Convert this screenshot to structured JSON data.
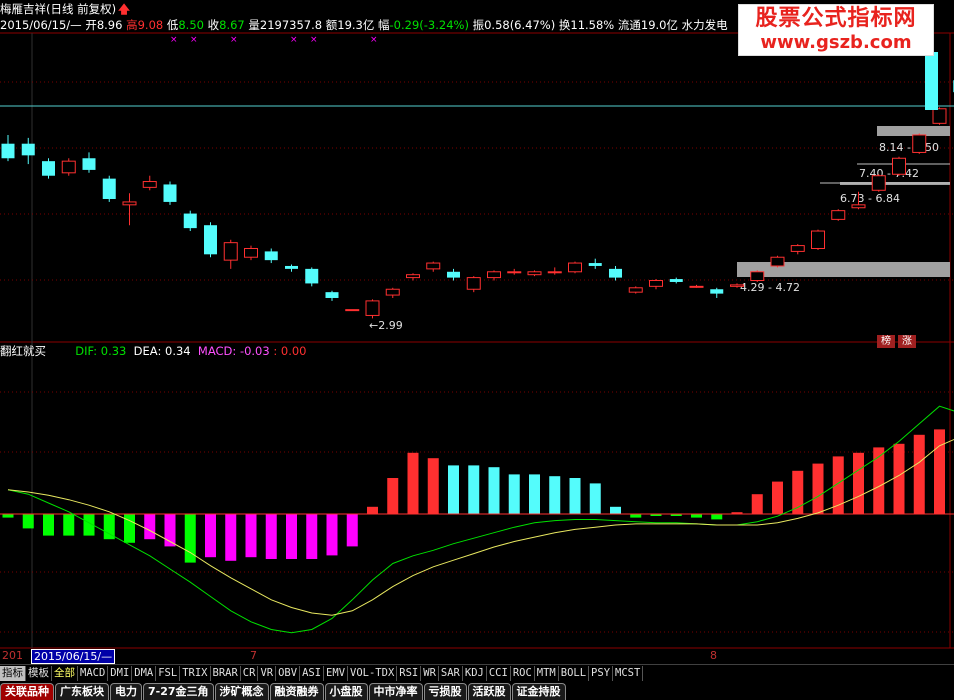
{
  "header": {
    "name": "梅雁吉祥",
    "period": "(日线 前复权)",
    "date": "2015/06/15/—",
    "open_label": "开",
    "open": "8.96",
    "high_label": "高",
    "high": "9.08",
    "low_label": "低",
    "low": "8.50",
    "close_label": "收",
    "close": "8.67",
    "volume_label": "量",
    "volume": "2197357.8",
    "amount_label": "额",
    "amount": "19.3亿",
    "change_label": "幅",
    "change": "-0.29(-3.24%)",
    "amplitude_label": "振",
    "amplitude": "0.58(6.47%)",
    "turnover_label": "换",
    "turnover": "11.58%",
    "float_label": "流通",
    "float": "19.0亿",
    "sector": "水力发电"
  },
  "watermark": {
    "line1": "股票公式指标网",
    "line2": "www.gszb.com"
  },
  "price_labels": [
    "8.14 - 8.50",
    "7.40 - 7.42",
    "6.73 - 6.84",
    "4.29 - 4.72"
  ],
  "low_marker": "2.99",
  "badges": [
    "榜",
    "涨"
  ],
  "indicator": {
    "name": "翻红就买",
    "dif_label": "DIF:",
    "dif": "0.33",
    "dea_label": "DEA:",
    "dea": "0.34",
    "macd_label": "MACD:",
    "macd": "-0.03",
    "extra": ": 0.00"
  },
  "axis": {
    "date_box": "2015/06/15/—",
    "left_cut": "201",
    "label_7": "7",
    "label_8": "8"
  },
  "tabs_row1": [
    "指标",
    "模板",
    "全部",
    "MACD",
    "DMI",
    "DMA",
    "FSL",
    "TRIX",
    "BRAR",
    "CR",
    "VR",
    "OBV",
    "ASI",
    "EMV",
    "VOL-TDX",
    "RSI",
    "WR",
    "SAR",
    "KDJ",
    "CCI",
    "ROC",
    "MTM",
    "BOLL",
    "PSY",
    "MCST"
  ],
  "tabs_row2": [
    "关联品种",
    "广东板块",
    "电力",
    "7-27金三角",
    "涉矿概念",
    "融资融券",
    "小盘股",
    "中市净率",
    "亏损股",
    "活跃股",
    "证金持股"
  ],
  "colors": {
    "up": "#ff3030",
    "down": "#54fcfc",
    "magenta": "#ff00ff",
    "green": "#00ff00",
    "dif": "#00e000",
    "dea": "#e8e860"
  },
  "chart_data": {
    "type": "candlestick",
    "candles": [
      {
        "o": 6.9,
        "c": 6.4,
        "h": 7.2,
        "l": 6.3
      },
      {
        "o": 6.9,
        "c": 6.5,
        "h": 7.1,
        "l": 6.2
      },
      {
        "o": 6.3,
        "c": 5.8,
        "h": 6.4,
        "l": 5.7
      },
      {
        "o": 5.9,
        "c": 6.3,
        "h": 6.4,
        "l": 5.8
      },
      {
        "o": 6.4,
        "c": 6.0,
        "h": 6.6,
        "l": 5.9
      },
      {
        "o": 5.7,
        "c": 5.0,
        "h": 5.8,
        "l": 4.9
      },
      {
        "o": 4.8,
        "c": 4.9,
        "h": 5.2,
        "l": 4.1
      },
      {
        "o": 5.4,
        "c": 5.6,
        "h": 5.8,
        "l": 5.3
      },
      {
        "o": 5.5,
        "c": 4.9,
        "h": 5.6,
        "l": 4.8
      },
      {
        "o": 4.5,
        "c": 4.0,
        "h": 4.6,
        "l": 3.9
      },
      {
        "o": 4.1,
        "c": 3.1,
        "h": 4.2,
        "l": 3.0
      },
      {
        "o": 2.9,
        "c": 3.5,
        "h": 3.6,
        "l": 2.6
      },
      {
        "o": 3.0,
        "c": 3.3,
        "h": 3.4,
        "l": 2.9
      },
      {
        "o": 3.2,
        "c": 2.9,
        "h": 3.3,
        "l": 2.8
      },
      {
        "o": 2.7,
        "c": 2.6,
        "h": 2.75,
        "l": 2.5
      },
      {
        "o": 2.6,
        "c": 2.1,
        "h": 2.65,
        "l": 2.0
      },
      {
        "o": 1.8,
        "c": 1.6,
        "h": 1.85,
        "l": 1.5
      },
      {
        "o": 1.2,
        "c": 1.2,
        "h": 1.2,
        "l": 1.2
      },
      {
        "o": 1.0,
        "c": 1.5,
        "h": 1.55,
        "l": 0.9
      },
      {
        "o": 1.7,
        "c": 1.9,
        "h": 1.95,
        "l": 1.6
      },
      {
        "o": 2.3,
        "c": 2.4,
        "h": 2.45,
        "l": 2.2
      },
      {
        "o": 2.6,
        "c": 2.8,
        "h": 2.85,
        "l": 2.5
      },
      {
        "o": 2.5,
        "c": 2.3,
        "h": 2.6,
        "l": 2.2
      },
      {
        "o": 1.9,
        "c": 2.3,
        "h": 2.35,
        "l": 1.8
      },
      {
        "o": 2.3,
        "c": 2.5,
        "h": 2.55,
        "l": 2.2
      },
      {
        "o": 2.5,
        "c": 2.5,
        "h": 2.6,
        "l": 2.4
      },
      {
        "o": 2.4,
        "c": 2.5,
        "h": 2.55,
        "l": 2.35
      },
      {
        "o": 2.5,
        "c": 2.5,
        "h": 2.65,
        "l": 2.4
      },
      {
        "o": 2.5,
        "c": 2.8,
        "h": 2.85,
        "l": 2.45
      },
      {
        "o": 2.8,
        "c": 2.7,
        "h": 2.95,
        "l": 2.6
      },
      {
        "o": 2.6,
        "c": 2.3,
        "h": 2.7,
        "l": 2.2
      },
      {
        "o": 1.8,
        "c": 1.95,
        "h": 2.0,
        "l": 1.75
      },
      {
        "o": 2.0,
        "c": 2.2,
        "h": 2.25,
        "l": 1.9
      },
      {
        "o": 2.25,
        "c": 2.15,
        "h": 2.3,
        "l": 2.1
      },
      {
        "o": 2.0,
        "c": 2.0,
        "h": 2.05,
        "l": 1.95
      },
      {
        "o": 1.9,
        "c": 1.75,
        "h": 1.95,
        "l": 1.6
      },
      {
        "o": 2.0,
        "c": 2.05,
        "h": 2.1,
        "l": 1.95
      },
      {
        "o": 2.2,
        "c": 2.5,
        "h": 2.55,
        "l": 2.15
      },
      {
        "o": 2.7,
        "c": 3.0,
        "h": 3.05,
        "l": 2.65
      },
      {
        "o": 3.2,
        "c": 3.4,
        "h": 3.45,
        "l": 3.1
      },
      {
        "o": 3.3,
        "c": 3.9,
        "h": 3.95,
        "l": 3.25
      },
      {
        "o": 4.3,
        "c": 4.6,
        "h": 4.65,
        "l": 4.25
      },
      {
        "o": 4.7,
        "c": 4.8,
        "h": 5.25,
        "l": 4.65
      },
      {
        "o": 5.3,
        "c": 5.8,
        "h": 5.85,
        "l": 5.25
      },
      {
        "o": 5.85,
        "c": 6.4,
        "h": 6.45,
        "l": 5.8
      },
      {
        "o": 6.6,
        "c": 7.2,
        "h": 7.25,
        "l": 6.55
      },
      {
        "o": 7.6,
        "c": 8.1,
        "h": 8.15,
        "l": 7.55
      },
      {
        "o": 9.08,
        "c": 8.67,
        "h": 9.08,
        "l": 8.5
      }
    ],
    "macd": [
      -0.02,
      -0.08,
      -0.12,
      -0.12,
      -0.12,
      -0.14,
      -0.16,
      -0.14,
      -0.18,
      -0.27,
      -0.24,
      -0.26,
      -0.24,
      -0.25,
      -0.25,
      -0.25,
      -0.23,
      -0.18,
      0.04,
      0.2,
      0.34,
      0.31,
      0.27,
      0.27,
      0.26,
      0.22,
      0.22,
      0.21,
      0.2,
      0.17,
      0.04,
      -0.02,
      -0.01,
      -0.01,
      -0.02,
      -0.03,
      0.01,
      0.11,
      0.18,
      0.24,
      0.28,
      0.32,
      0.34,
      0.37,
      0.39,
      0.44,
      0.47,
      0.28
    ],
    "dif": [
      0.22,
      0.18,
      0.1,
      0.02,
      -0.08,
      -0.18,
      -0.28,
      -0.38,
      -0.5,
      -0.62,
      -0.75,
      -0.88,
      -0.98,
      -1.05,
      -1.08,
      -1.05,
      -0.95,
      -0.78,
      -0.6,
      -0.45,
      -0.38,
      -0.33,
      -0.27,
      -0.22,
      -0.17,
      -0.12,
      -0.08,
      -0.06,
      -0.05,
      -0.05,
      -0.06,
      -0.07,
      -0.08,
      -0.08,
      -0.09,
      -0.1,
      -0.1,
      -0.07,
      -0.02,
      0.06,
      0.16,
      0.28,
      0.4,
      0.52,
      0.66,
      0.82,
      0.98,
      0.92
    ],
    "dea": [
      0.22,
      0.2,
      0.17,
      0.13,
      0.08,
      0.02,
      -0.06,
      -0.15,
      -0.25,
      -0.35,
      -0.47,
      -0.58,
      -0.68,
      -0.78,
      -0.85,
      -0.9,
      -0.92,
      -0.88,
      -0.78,
      -0.66,
      -0.56,
      -0.48,
      -0.42,
      -0.36,
      -0.3,
      -0.25,
      -0.21,
      -0.17,
      -0.14,
      -0.12,
      -0.1,
      -0.09,
      -0.09,
      -0.09,
      -0.09,
      -0.1,
      -0.1,
      -0.1,
      -0.08,
      -0.04,
      0.01,
      0.08,
      0.16,
      0.25,
      0.35,
      0.47,
      0.62,
      0.7
    ]
  }
}
